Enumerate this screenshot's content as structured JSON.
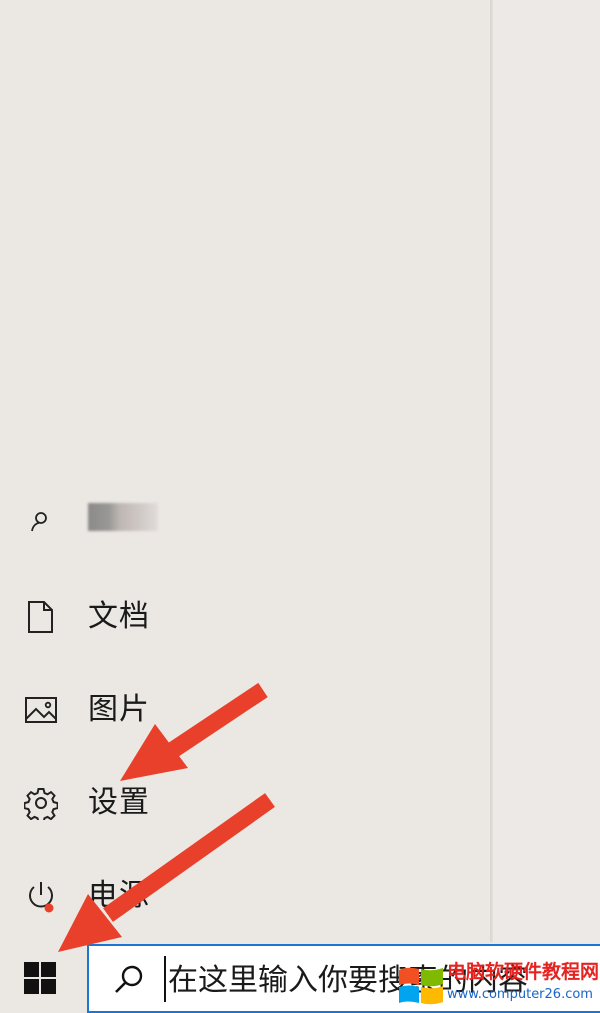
{
  "start_menu": {
    "user": {
      "name": ""
    },
    "items": [
      {
        "id": "documents",
        "label": "文档",
        "icon": "document-icon"
      },
      {
        "id": "pictures",
        "label": "图片",
        "icon": "picture-icon"
      },
      {
        "id": "settings",
        "label": "设置",
        "icon": "gear-icon"
      },
      {
        "id": "power",
        "label": "电源",
        "icon": "power-icon"
      }
    ]
  },
  "taskbar": {
    "search_placeholder": "在这里输入你要搜索的内容",
    "start_icon": "windows-logo-icon",
    "search_icon": "search-icon"
  },
  "watermark": {
    "title": "电脑软硬件教程网",
    "url": "www.computer26.com"
  },
  "colors": {
    "annotation_arrow": "#e8402a",
    "search_border": "#1976d2",
    "notification_dot": "#e8402a"
  }
}
